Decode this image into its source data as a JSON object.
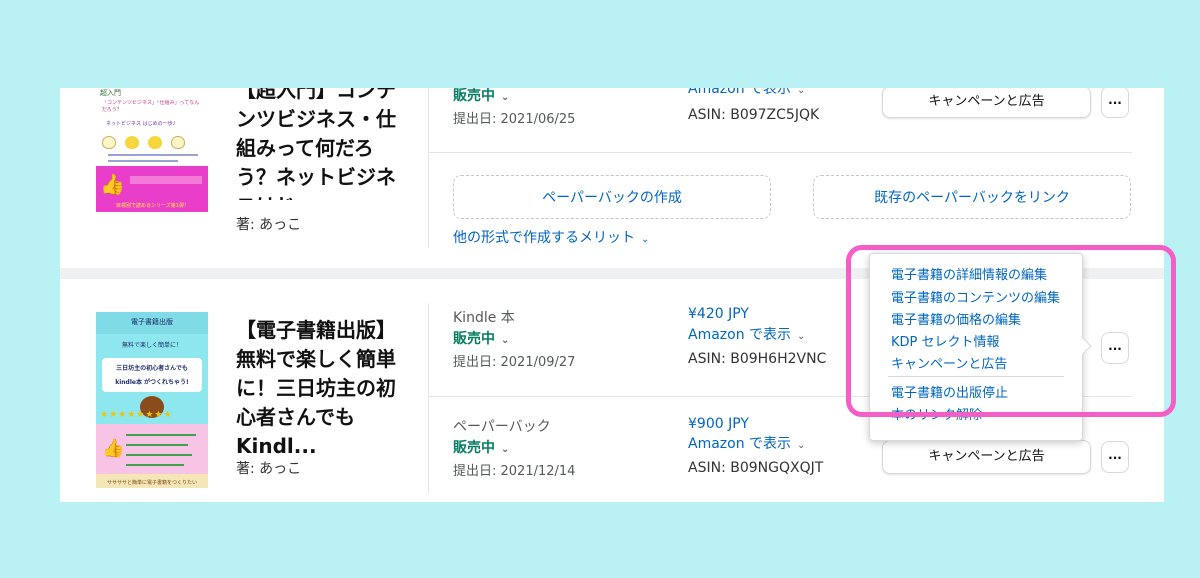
{
  "book1": {
    "cover": {
      "title_label": "超入門",
      "subtitle": "「コンテンツビジネス」「仕組み」ってなんだろう？",
      "net_business": "ネットビジネス はじめの一歩♪",
      "bottom_text": "目標別で読めるシリーズ第1弾！"
    },
    "title": "【超入門】コンテンツビジネス・仕組みって何だろう？ネットビジネスはじ...",
    "author": "著: あっこ",
    "ebook": {
      "status": "販売中",
      "submit_date": "提出日: 2021/06/25",
      "amazon_link": "Amazon で表示",
      "asin": "ASIN: B097ZC5JQK",
      "campaign_button": "キャンペーンと広告",
      "more_button": "..."
    },
    "paperback_create": "ペーパーバックの作成",
    "paperback_link": "既存のペーパーバックをリンク",
    "merits_link": "他の形式で作成するメリット"
  },
  "book2": {
    "cover": {
      "top_label": "電子書籍出版",
      "subtitle": "無料で楽しく簡単に！",
      "title_lines": [
        "三日坊主の初心者さんでも",
        "kindle本 がつくれちゃう!"
      ],
      "bottom_text": "ササササと簡単に電子書籍をつくりたい"
    },
    "title": "【電子書籍出版】無料で楽しく簡単に！三日坊主の初心者さんでもKindl...",
    "author": "著: あっこ",
    "kindle": {
      "format": "Kindle 本",
      "status": "販売中",
      "submit_date": "提出日: 2021/09/27",
      "price": "¥420 JPY",
      "amazon_link": "Amazon で表示",
      "asin": "ASIN: B09H6H2VNC",
      "more_button": "..."
    },
    "paperback": {
      "format": "ペーパーバック",
      "status": "販売中",
      "submit_date": "提出日: 2021/12/14",
      "price": "¥900 JPY",
      "amazon_link": "Amazon で表示",
      "asin": "ASIN: B09NGQXQJT",
      "campaign_button": "キャンペーンと広告",
      "more_button": "..."
    }
  },
  "dropdown": {
    "items": [
      "電子書籍の詳細情報の編集",
      "電子書籍のコンテンツの編集",
      "電子書籍の価格の編集",
      "KDP セレクト情報",
      "キャンペーンと広告",
      "電子書籍の出版停止",
      "本のリンク解除"
    ]
  },
  "colors": {
    "background": "#b9f1f4",
    "highlight": "#f55ec6",
    "link": "#0066c0",
    "status_green": "#067d62"
  },
  "icons": {
    "chevron": "chevron-down-icon"
  }
}
